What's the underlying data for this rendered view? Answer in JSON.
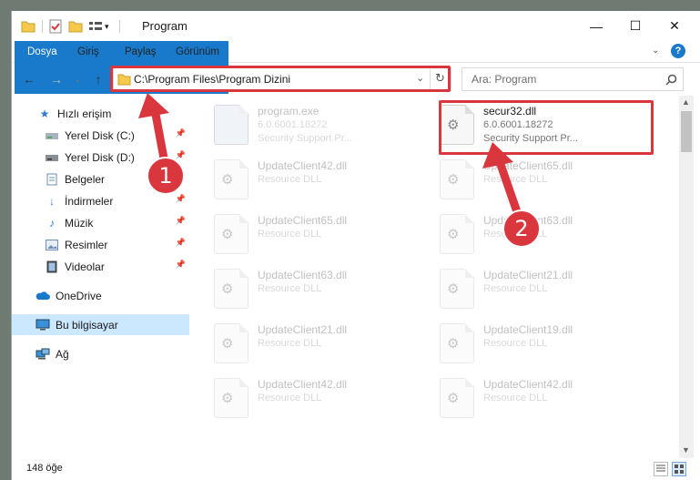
{
  "window": {
    "title": "Program",
    "controls": {
      "minimize": "—",
      "maximize": "☐",
      "close": "✕"
    }
  },
  "ribbon": {
    "tabs": [
      {
        "label": "Dosya"
      },
      {
        "label": "Giriş"
      },
      {
        "label": "Paylaş"
      },
      {
        "label": "Görünüm"
      }
    ],
    "expand_icon": "chevron-down-icon",
    "help_icon": "help-icon"
  },
  "address_bar": {
    "path": "C:\\Program Files\\Program Dizini",
    "search_placeholder": "Ara: Program"
  },
  "sidebar": {
    "items": [
      {
        "label": "Hızlı erişim",
        "icon": "star-icon"
      },
      {
        "label": "Yerel Disk (C:)",
        "icon": "drive-icon",
        "pinned": true
      },
      {
        "label": "Yerel Disk (D:)",
        "icon": "drive-icon",
        "pinned": true
      },
      {
        "label": "Belgeler",
        "icon": "documents-icon",
        "pinned": true
      },
      {
        "label": "İndirmeler",
        "icon": "download-icon",
        "pinned": true
      },
      {
        "label": "Müzik",
        "icon": "music-icon",
        "pinned": true
      },
      {
        "label": "Resimler",
        "icon": "pictures-icon",
        "pinned": true
      },
      {
        "label": "Videolar",
        "icon": "videos-icon",
        "pinned": true
      },
      {
        "label": "OneDrive",
        "icon": "cloud-icon"
      },
      {
        "label": "Bu bilgisayar",
        "icon": "computer-icon",
        "selected": true
      },
      {
        "label": "Ağ",
        "icon": "network-icon"
      }
    ]
  },
  "files": [
    {
      "name": "program.exe",
      "line1": "6.0.6001.18272",
      "line2": "Security Support Pr...",
      "faded": true
    },
    {
      "name": "secur32.dll",
      "line1": "6.0.6001.18272",
      "line2": "Security Support Pr...",
      "faded": false,
      "highlighted": true
    },
    {
      "name": "UpdateClient42.dll",
      "line1": "Resource DLL",
      "faded": true
    },
    {
      "name": "UpdateClient65.dll",
      "line1": "Resource DLL",
      "faded": true
    },
    {
      "name": "UpdateClient65.dll",
      "line1": "Resource DLL",
      "faded": true
    },
    {
      "name": "UpdateClient63.dll",
      "line1": "Resource DLL",
      "faded": true
    },
    {
      "name": "UpdateClient63.dll",
      "line1": "Resource DLL",
      "faded": true
    },
    {
      "name": "UpdateClient21.dll",
      "line1": "Resource DLL",
      "faded": true
    },
    {
      "name": "UpdateClient21.dll",
      "line1": "Resource DLL",
      "faded": true
    },
    {
      "name": "UpdateClient19.dll",
      "line1": "Resource DLL",
      "faded": true
    },
    {
      "name": "UpdateClient42.dll",
      "line1": "Resource DLL",
      "faded": true
    },
    {
      "name": "UpdateClient42.dll",
      "line1": "Resource DLL",
      "faded": true
    }
  ],
  "status": {
    "item_count": "148 öğe"
  },
  "annotations": [
    {
      "number": "1"
    },
    {
      "number": "2"
    }
  ],
  "colors": {
    "accent": "#1979ca",
    "highlight_red": "#d9363e",
    "selection": "#cce8ff"
  }
}
